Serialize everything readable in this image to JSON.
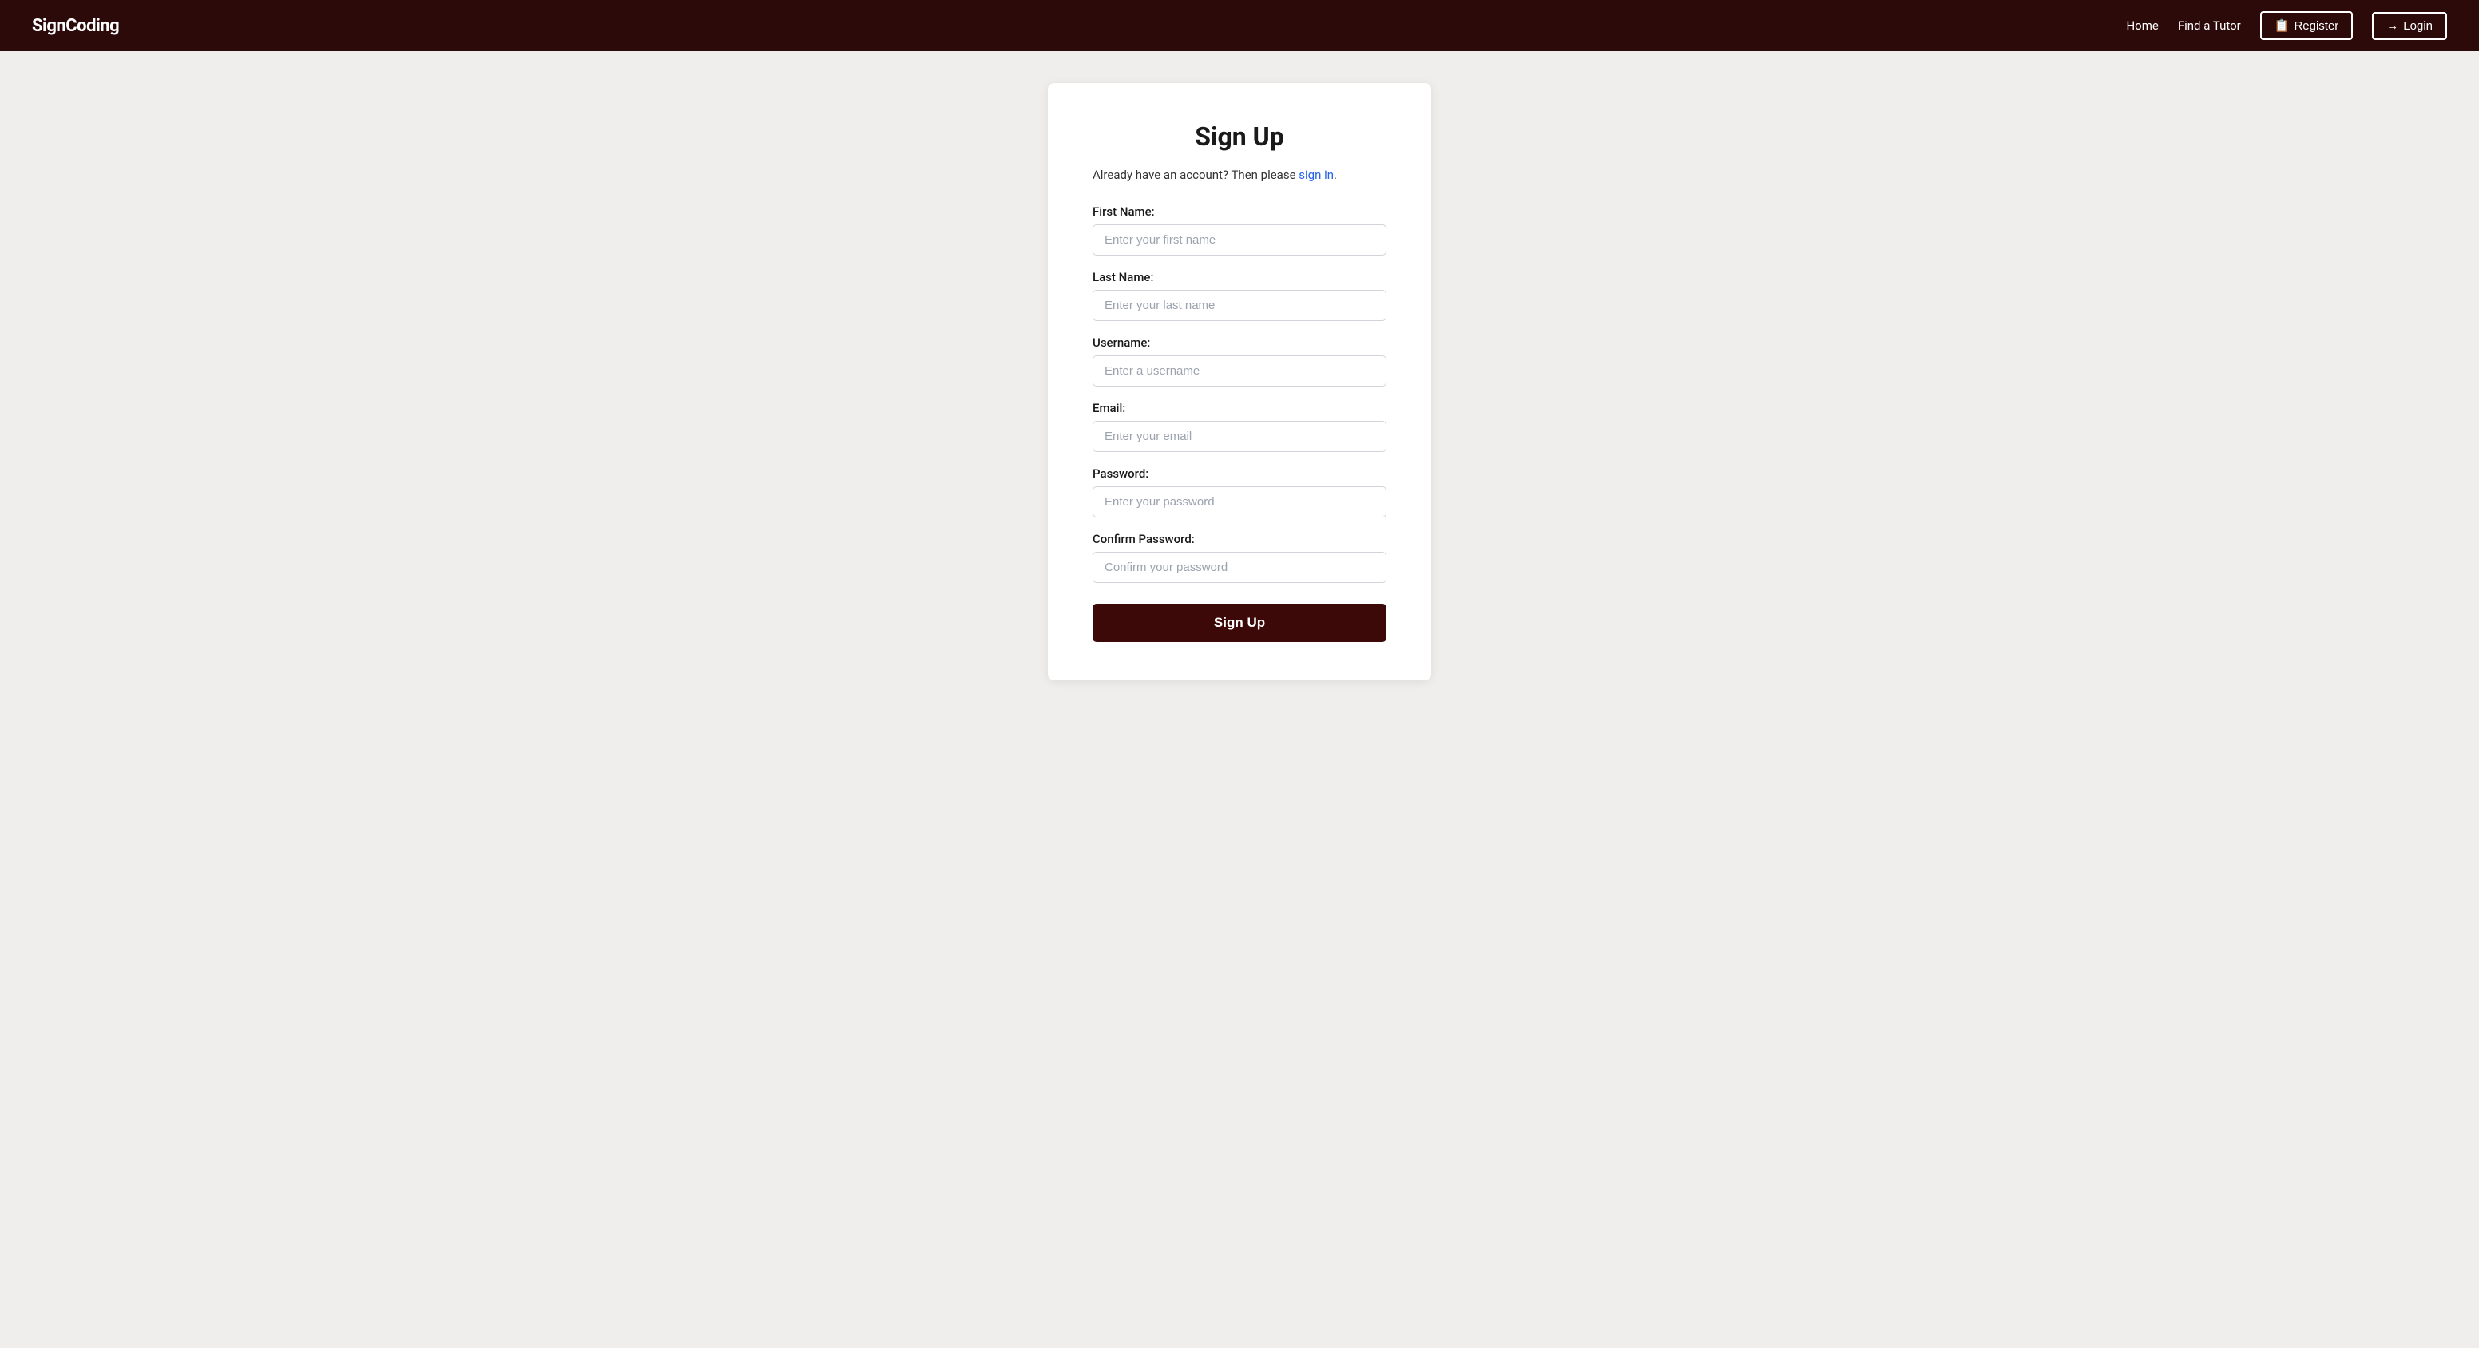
{
  "nav": {
    "logo": "SignCoding",
    "links": [
      {
        "label": "Home",
        "name": "home-link"
      },
      {
        "label": "Find a Tutor",
        "name": "find-tutor-link"
      }
    ],
    "register_label": "Register",
    "login_label": "Login",
    "register_icon": "🪪",
    "login_icon": "➡️"
  },
  "page": {
    "title": "Sign Up",
    "signin_prefix": "Already have an account? Then please ",
    "signin_link": "sign in",
    "signin_suffix": ".",
    "fields": [
      {
        "label": "First Name:",
        "placeholder": "Enter your first name",
        "name": "first-name-input",
        "type": "text"
      },
      {
        "label": "Last Name:",
        "placeholder": "Enter your last name",
        "name": "last-name-input",
        "type": "text"
      },
      {
        "label": "Username:",
        "placeholder": "Enter a username",
        "name": "username-input",
        "type": "text"
      },
      {
        "label": "Email:",
        "placeholder": "Enter your email",
        "name": "email-input",
        "type": "email"
      },
      {
        "label": "Password:",
        "placeholder": "Enter your password",
        "name": "password-input",
        "type": "password"
      },
      {
        "label": "Confirm Password:",
        "placeholder": "Confirm your password",
        "name": "confirm-password-input",
        "type": "password"
      }
    ],
    "submit_label": "Sign Up"
  }
}
